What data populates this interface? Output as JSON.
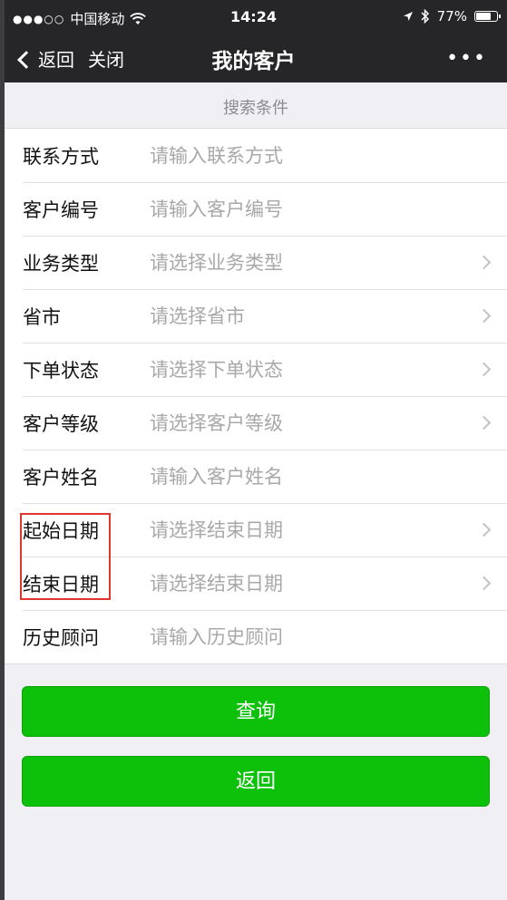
{
  "status_bar": {
    "signal": "●●●○○",
    "carrier": "中国移动",
    "wifi_icon": "wifi-icon",
    "time": "14:24",
    "battery": "77%",
    "battery_level": 0.77
  },
  "nav": {
    "back_label": "返回",
    "close_label": "关闭",
    "title": "我的客户",
    "more_label": "•••"
  },
  "section_header": "搜索条件",
  "form": {
    "rows": [
      {
        "label": "联系方式",
        "placeholder": "请输入联系方式",
        "type": "input"
      },
      {
        "label": "客户编号",
        "placeholder": "请输入客户编号",
        "type": "input"
      },
      {
        "label": "业务类型",
        "placeholder": "请选择业务类型",
        "type": "select"
      },
      {
        "label": "省市",
        "placeholder": "请选择省市",
        "type": "select"
      },
      {
        "label": "下单状态",
        "placeholder": "请选择下单状态",
        "type": "select"
      },
      {
        "label": "客户等级",
        "placeholder": "请选择客户等级",
        "type": "select"
      },
      {
        "label": "客户姓名",
        "placeholder": "请输入客户姓名",
        "type": "input"
      },
      {
        "label": "起始日期",
        "placeholder": "请选择结束日期",
        "type": "select"
      },
      {
        "label": "结束日期",
        "placeholder": "请选择结束日期",
        "type": "select"
      },
      {
        "label": "历史顾问",
        "placeholder": "请输入历史顾问",
        "type": "input"
      }
    ]
  },
  "buttons": {
    "query_label": "查询",
    "back_label": "返回"
  },
  "colors": {
    "primary_button": "#0dc10b",
    "highlight_box": "#e0342e",
    "nav_background": "#262629"
  }
}
